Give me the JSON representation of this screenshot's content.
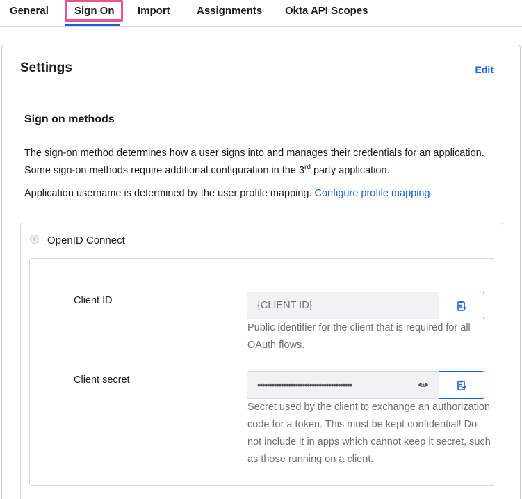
{
  "tabs": [
    {
      "label": "General"
    },
    {
      "label": "Sign On"
    },
    {
      "label": "Import"
    },
    {
      "label": "Assignments"
    },
    {
      "label": "Okta API Scopes"
    }
  ],
  "active_tab": "Sign On",
  "colors": {
    "accent": "#1662dd",
    "highlight": "#e8558b",
    "text": "#1d1d21",
    "muted": "#6e6e78",
    "border": "#d7d7dc",
    "input_bg": "#f2f2f4"
  },
  "settings": {
    "title": "Settings",
    "edit_label": "Edit"
  },
  "sign_on_methods": {
    "title": "Sign on methods",
    "description_part1": "The sign-on method determines how a user signs into and manages their credentials for an application. Some sign-on methods require additional configuration in the 3",
    "description_sup": "rd",
    "description_part2": " party application.",
    "username_text": "Application username is determined by the user profile mapping.",
    "username_link": "Configure profile mapping"
  },
  "method": {
    "label": "OpenID Connect",
    "client_id": {
      "label": "Client ID",
      "value": "{CLIENT ID}",
      "help": "Public identifier for the client that is required for all OAuth flows.",
      "copy_icon": "clipboard-icon"
    },
    "client_secret": {
      "label": "Client secret",
      "value": "••••••••••••••••••••••••••••••••••••••••",
      "help": "Secret used by the client to exchange an authorization code for a token. This must be kept confidential! Do not include it in apps which cannot keep it secret, such as those running on a client.",
      "reveal_icon": "eye-icon",
      "copy_icon": "clipboard-icon"
    }
  }
}
